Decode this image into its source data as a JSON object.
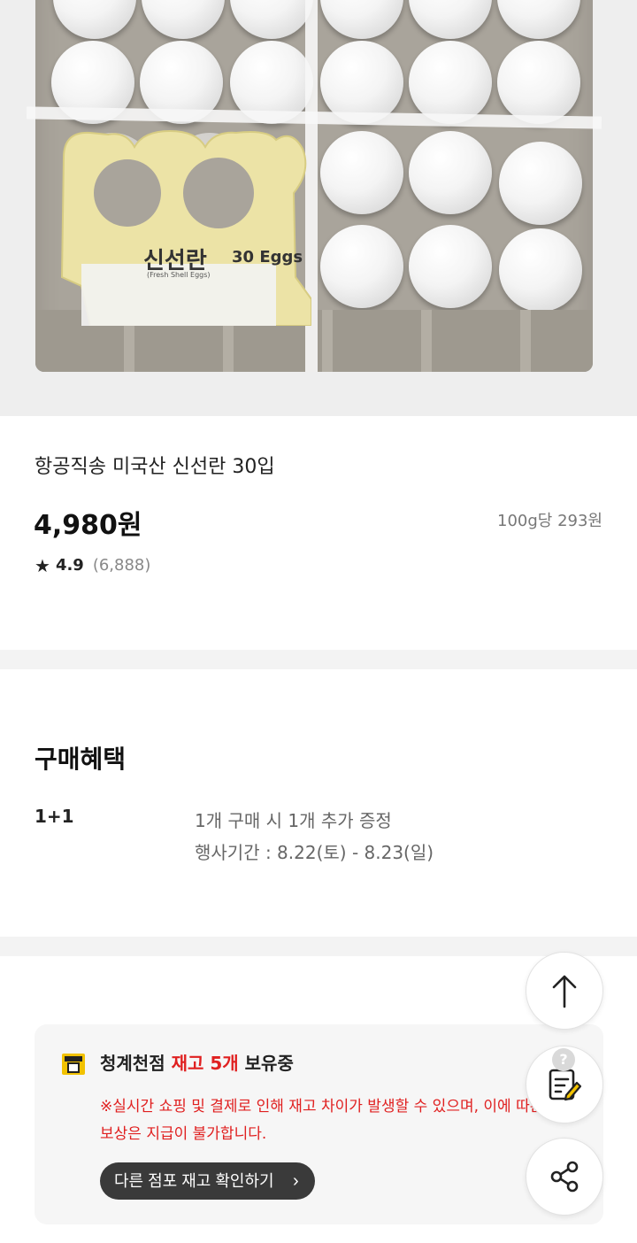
{
  "product": {
    "brand_label": "신선란",
    "eggs_label": "30 Eggs",
    "eggs_sub": "(Fresh Shell Eggs)",
    "title": "항공직송 미국산 신선란 30입",
    "price": "4,980원",
    "unit_price": "100g당 293원",
    "rating": "4.9",
    "review_count": "(6,888)"
  },
  "benefits": {
    "heading": "구매혜택",
    "tag": "1+1",
    "description": "1개 구매 시 1개 추가 증정",
    "period": "행사기간 : 8.22(토) - 8.23(일)"
  },
  "stock": {
    "store_name": "청계천점",
    "stock_status": "재고 5개",
    "suffix": "보유중",
    "notice": "※실시간 쇼핑 및 결제로 인해 재고 차이가 발생할 수 있으며, 이에 따른 보상은 지급이 불가합니다.",
    "other_store_button": "다른 점포 재고 확인하기",
    "chevron": "›"
  },
  "floating": {
    "help_badge": "?"
  },
  "icons": {
    "star": "star-icon",
    "store": "store-icon",
    "scroll_top": "arrow-up-icon",
    "review": "edit-note-icon",
    "share": "share-icon"
  },
  "colors": {
    "accent_red": "#e02020",
    "store_icon": "#f2c200",
    "button_dark": "#3a3a3a"
  }
}
